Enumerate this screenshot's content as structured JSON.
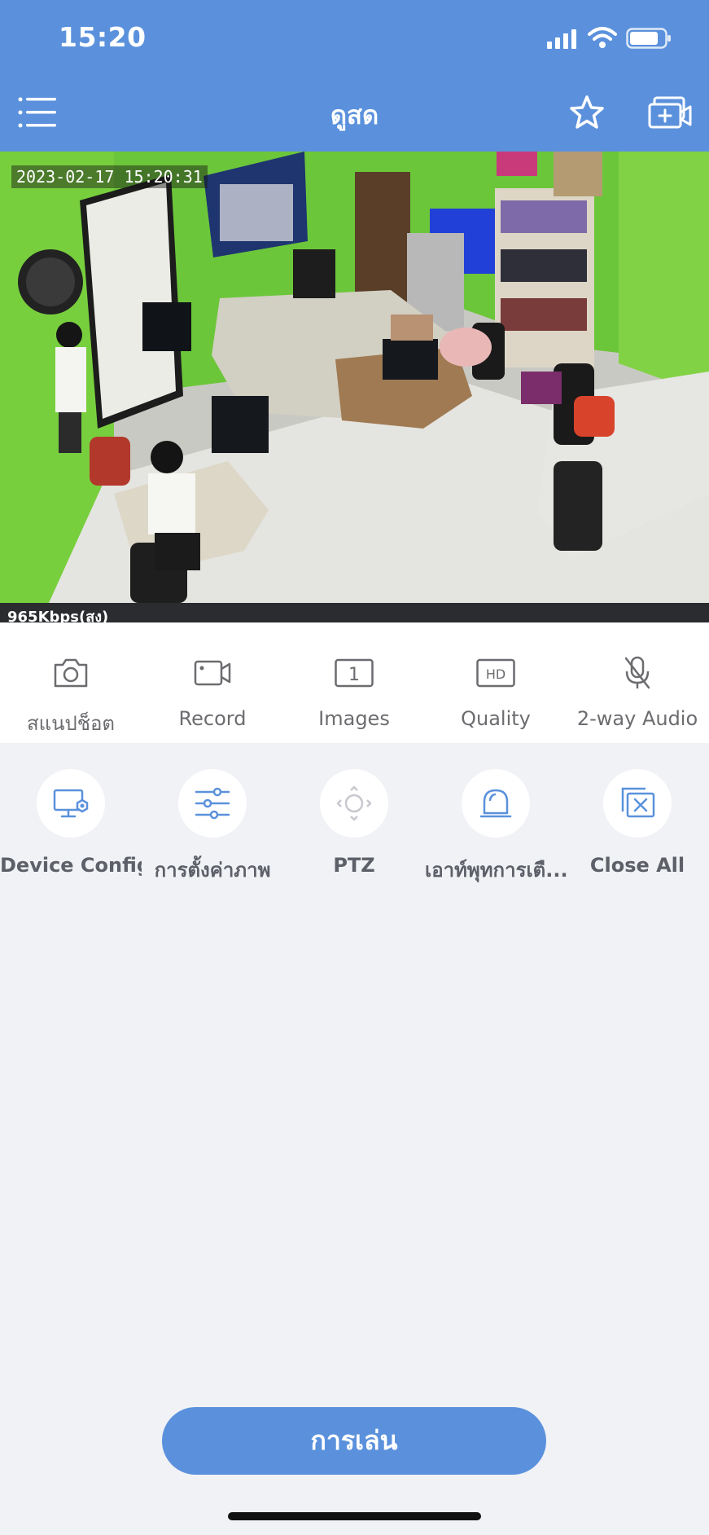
{
  "status_bar": {
    "time": "15:20"
  },
  "header": {
    "title": "ดูสด"
  },
  "video": {
    "timestamp": "2023-02-17 15:20:31",
    "bitrate": "965Kbps(สูง)"
  },
  "actions": [
    {
      "label": "สแนปช็อต",
      "icon": "camera-icon"
    },
    {
      "label": "Record",
      "icon": "video-record-icon"
    },
    {
      "label": "Images",
      "icon": "single-image-layout-icon",
      "badge": "1"
    },
    {
      "label": "Quality",
      "icon": "hd-quality-icon",
      "badge": "HD"
    },
    {
      "label": "2-way Audio",
      "icon": "microphone-muted-icon"
    }
  ],
  "tools": [
    {
      "label": "Device Config",
      "icon": "monitor-settings-icon"
    },
    {
      "label": "การตั้งค่าภาพ",
      "icon": "sliders-icon"
    },
    {
      "label": "PTZ",
      "icon": "ptz-joystick-icon"
    },
    {
      "label": "เอาท์พุทการเตื...",
      "icon": "alarm-light-icon"
    },
    {
      "label": "Close All",
      "icon": "close-all-windows-icon"
    }
  ],
  "playback": {
    "label": "การเล่น"
  },
  "colors": {
    "brand": "#5b91dc",
    "background": "#f1f2f6"
  }
}
